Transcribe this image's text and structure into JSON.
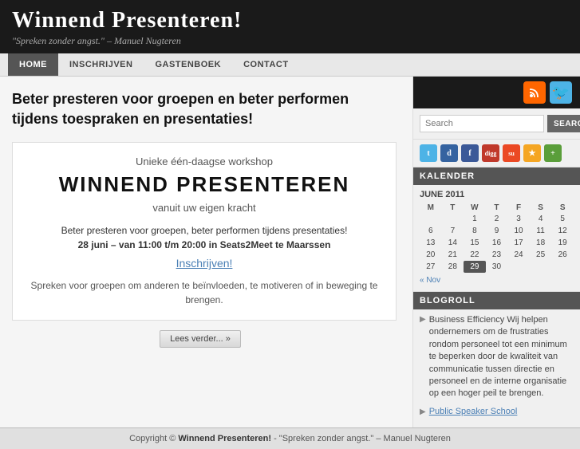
{
  "site": {
    "title": "Winnend Presenteren!",
    "tagline": "\"Spreken zonder angst.\" – Manuel Nugteren"
  },
  "nav": {
    "items": [
      {
        "label": "HOME",
        "active": true
      },
      {
        "label": "INSCHRIJVEN",
        "active": false
      },
      {
        "label": "GASTENBOEK",
        "active": false
      },
      {
        "label": "CONTACT",
        "active": false
      }
    ]
  },
  "main": {
    "headline": "Beter presteren voor groepen en beter performen tijdens toespraken en presentaties!",
    "article": {
      "workshop_intro": "Unieke één-daagse workshop",
      "workshop_title": "WINNEND PRESENTEREN",
      "workshop_subtitle": "vanuit uw eigen kracht",
      "description": "Beter presteren voor groepen, beter performen tijdens presentaties!",
      "date_line": "28 juni – van 11:00 t/m 20:00 in Seats2Meet te Maarssen",
      "link_text": "Inschrijven!",
      "body_text": "Spreken voor groepen om anderen te beïnvloeden,\nte motiveren of in beweging te brengen.",
      "read_more": "Lees verder... »"
    }
  },
  "sidebar": {
    "search": {
      "placeholder": "Search",
      "button_label": "SEARCH"
    },
    "social_icons": [
      "t",
      "d",
      "f",
      "digg",
      "su",
      "★",
      "+"
    ],
    "calendar": {
      "title": "KALENDER",
      "month_year": "JUNE 2011",
      "headers": [
        "M",
        "T",
        "W",
        "T",
        "F",
        "S",
        "S"
      ],
      "rows": [
        [
          "",
          "",
          "1",
          "2",
          "3",
          "4",
          "5"
        ],
        [
          "6",
          "7",
          "8",
          "9",
          "10",
          "11",
          "12"
        ],
        [
          "13",
          "14",
          "15",
          "16",
          "17",
          "18",
          "19"
        ],
        [
          "20",
          "21",
          "22",
          "23",
          "24",
          "25",
          "26"
        ],
        [
          "27",
          "28",
          "29",
          "30",
          "",
          "",
          ""
        ]
      ],
      "today": "29",
      "nav_prev": "« Nov"
    },
    "blogroll": {
      "title": "BLOGROLL",
      "items": [
        {
          "type": "text",
          "text": "Business Efficiency Wij helpen ondernemers om de frustraties rondom personeel tot een minimum te beperken door de kwaliteit van communicatie tussen directie en personeel en de interne organisatie op een hoger peil te brengen."
        },
        {
          "type": "link",
          "text": "Public Speaker School"
        }
      ]
    }
  },
  "footer": {
    "text": "Copyright © Winnend Presenteren! - \"Spreken zonder angst.\" – Manuel Nugteren"
  }
}
